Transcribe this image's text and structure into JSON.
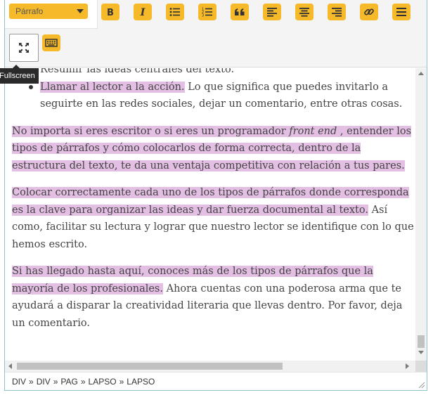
{
  "toolbar": {
    "format_select": {
      "value": "Párrafo"
    },
    "buttons": [
      "bold-icon",
      "italic-icon",
      "bulleted-list-icon",
      "numbered-list-icon",
      "quote-icon",
      "align-left-icon",
      "align-center-icon",
      "align-right-icon",
      "link-icon",
      "horizontal-rule-icon",
      "fullscreen-icon",
      "keyboard-icon"
    ],
    "accent_color": "#f5b92a"
  },
  "tooltip": {
    "text": "Fullscreen"
  },
  "content": {
    "list_items": [
      {
        "plain": "Resumir las ideas centrales del texto."
      },
      {
        "highlight": "Llamar al lector a la acción.",
        "rest": " Lo que significa que puedes invitarlo a seguirte en las redes sociales, dejar un comentario, entre otras cosas."
      }
    ],
    "paragraphs": [
      {
        "hl_before": "No importa si eres escritor o si eres un programador ",
        "hl_em": "front end",
        "hl_after": " , entender los tipos de párrafos y cómo colocarlos de forma correcta, dentro de la estructura del texto, te da una ventaja competitiva con relación a tus pares."
      },
      {
        "highlight": "Colocar correctamente cada uno de los tipos de párrafos donde corresponda es la clave para organizar las ideas y dar fuerza documental al texto.",
        "rest": " Así como, facilitar su lectura y lograr que nuestro lector se identifique con lo que hemos escrito."
      },
      {
        "highlight": "Si has llegado hasta aquí, conoces más de los tipos de párrafos que la mayoría de los profesionales.",
        "rest": " Ahora cuentas con una poderosa arma que te ayudará a disparar la creatividad literaria que llevas dentro. Por favor, deja un comentario."
      }
    ],
    "highlight_color": "#e4bfe4"
  },
  "statusbar": {
    "path": [
      "DIV",
      "DIV",
      "PAG",
      "LAPSO",
      "LAPSO"
    ],
    "separator": "»"
  }
}
